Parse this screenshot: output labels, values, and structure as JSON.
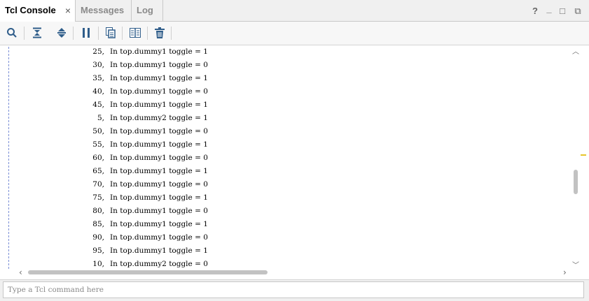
{
  "tabs": [
    {
      "label": "Tcl Console",
      "active": true,
      "close_icon": "×"
    },
    {
      "label": "Messages",
      "active": false
    },
    {
      "label": "Log",
      "active": false
    }
  ],
  "window_controls": {
    "help": "?",
    "minimize": "_",
    "restore": "□",
    "float": "⧉"
  },
  "toolbar": {
    "icons": [
      "search-icon",
      "collapse-all-icon",
      "expand-all-icon",
      "pause-icon",
      "copy-icon",
      "columns-icon",
      "delete-icon"
    ]
  },
  "console": {
    "lines": [
      {
        "time": "25,",
        "text": "In top.dummy1 toggle = 1"
      },
      {
        "time": "30,",
        "text": "In top.dummy1 toggle = 0"
      },
      {
        "time": "35,",
        "text": "In top.dummy1 toggle = 1"
      },
      {
        "time": "40,",
        "text": "In top.dummy1 toggle = 0"
      },
      {
        "time": "45,",
        "text": "In top.dummy1 toggle = 1"
      },
      {
        "time": "5,",
        "text": "In top.dummy2 toggle = 1"
      },
      {
        "time": "50,",
        "text": "In top.dummy1 toggle = 0"
      },
      {
        "time": "55,",
        "text": "In top.dummy1 toggle = 1"
      },
      {
        "time": "60,",
        "text": "In top.dummy1 toggle = 0"
      },
      {
        "time": "65,",
        "text": "In top.dummy1 toggle = 1"
      },
      {
        "time": "70,",
        "text": "In top.dummy1 toggle = 0"
      },
      {
        "time": "75,",
        "text": "In top.dummy1 toggle = 1"
      },
      {
        "time": "80,",
        "text": "In top.dummy1 toggle = 0"
      },
      {
        "time": "85,",
        "text": "In top.dummy1 toggle = 1"
      },
      {
        "time": "90,",
        "text": "In top.dummy1 toggle = 0"
      },
      {
        "time": "95,",
        "text": "In top.dummy1 toggle = 1"
      },
      {
        "time": "10,",
        "text": "In top.dummy2 toggle = 0"
      }
    ]
  },
  "command_input": {
    "placeholder": "Type a Tcl command here",
    "value": ""
  },
  "colors": {
    "accent_marker": "#e7c52a",
    "icon_blue": "#2f5d8a"
  }
}
